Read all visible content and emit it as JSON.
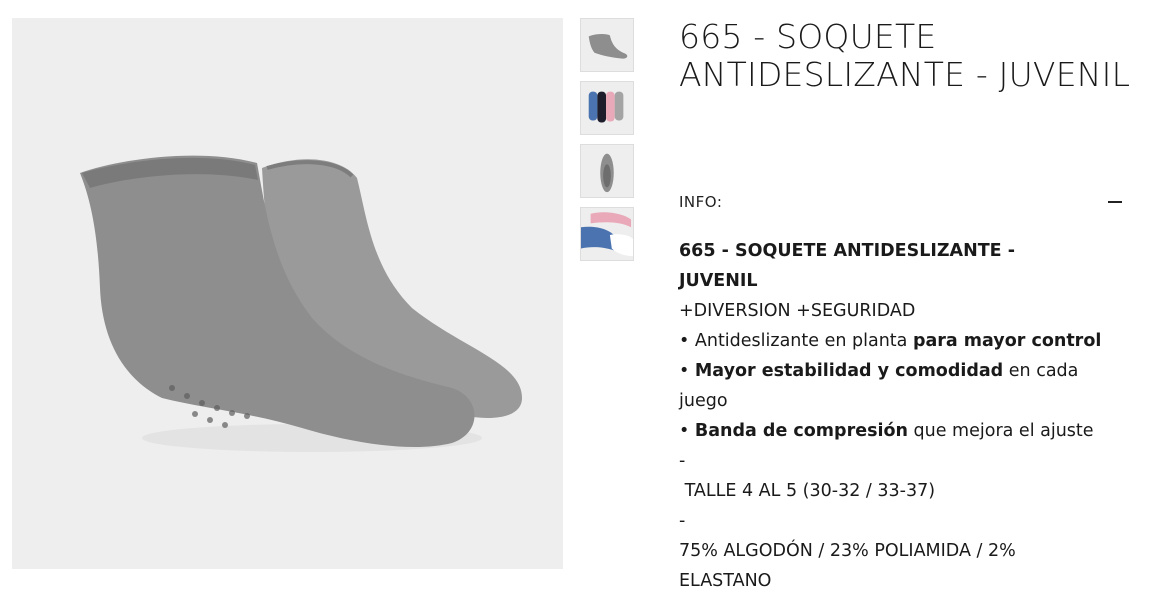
{
  "product": {
    "title": "665 - SOQUETE ANTIDESLIZANTE - JUVENIL",
    "main_image_alt": "grey-anti-slip-socks",
    "thumbnails": [
      "grey-socks-pair",
      "multicolor-socks-set",
      "grey-sock-sole",
      "pink-blue-white-socks"
    ]
  },
  "info": {
    "label": "INFO:",
    "toggle_icon": "minus-icon"
  },
  "description": {
    "heading_line1": "665 - SOQUETE ANTIDESLIZANTE -",
    "heading_line2": "JUVENIL",
    "tagline": "+DIVERSION +SEGURIDAD",
    "b1_prefix": "•  Antideslizante en planta ",
    "b1_bold": "para mayor control",
    "b2_prefix": "• ",
    "b2_bold": "Mayor estabilidad y comodidad",
    "b2_suffix": " en cada",
    "b2_cont": "juego",
    "b3_prefix": "• ",
    "b3_bold": "Banda de compresión",
    "b3_suffix": " que mejora el ajuste",
    "sep1": "-",
    "size": " TALLE 4 AL 5 (30-32 / 33-37)",
    "sep2": "-",
    "material_line1": "75% ALGODÓN / 23% POLIAMIDA / 2%",
    "material_line2": "ELASTANO"
  },
  "colors": {
    "sock_grey": "#8e8e8e",
    "background": "#eeeeee",
    "pink": "#e9a9b8",
    "blue": "#4a73b0",
    "navy": "#1d1d2c"
  }
}
